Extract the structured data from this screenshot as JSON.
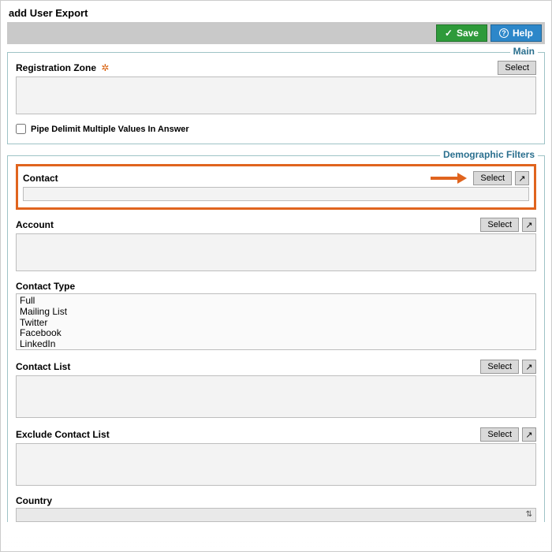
{
  "page": {
    "title": "add User Export"
  },
  "toolbar": {
    "save_label": "Save",
    "help_label": "Help"
  },
  "common": {
    "select_label": "Select"
  },
  "sections": {
    "main": {
      "title": "Main",
      "registration_zone": {
        "label": "Registration Zone"
      },
      "pipe_delimit": {
        "label": "Pipe Delimit Multiple Values In Answer",
        "checked": false
      }
    },
    "demographic": {
      "title": "Demographic Filters",
      "contact": {
        "label": "Contact"
      },
      "account": {
        "label": "Account"
      },
      "contact_type": {
        "label": "Contact Type",
        "options": [
          "Full",
          "Mailing List",
          "Twitter",
          "Facebook",
          "LinkedIn"
        ]
      },
      "contact_list": {
        "label": "Contact List"
      },
      "exclude_contact_list": {
        "label": "Exclude Contact List"
      },
      "country": {
        "label": "Country"
      }
    }
  }
}
